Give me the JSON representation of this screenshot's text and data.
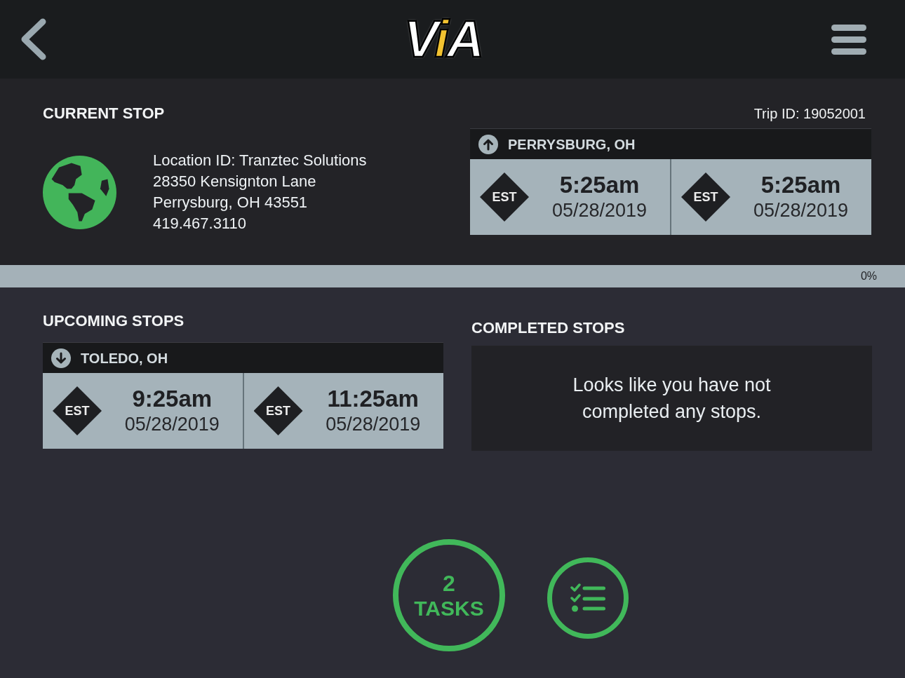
{
  "header": {
    "logo": "ViA"
  },
  "current_stop": {
    "title": "CURRENT STOP",
    "trip_id": "Trip ID: 19052001",
    "details": [
      "Location ID: Tranztec Solutions",
      "28350 Kensignton Lane",
      "Perrysburg, OH 43551",
      "419.467.3110"
    ],
    "stop": {
      "city": "PERRYSBURG, OH",
      "kind": "up",
      "times": [
        {
          "zone": "EST",
          "time": "5:25am",
          "date": "05/28/2019"
        },
        {
          "zone": "EST",
          "time": "5:25am",
          "date": "05/28/2019"
        }
      ]
    }
  },
  "progress": {
    "level": 0,
    "reading": "0%"
  },
  "upcoming_stops": {
    "title": "UPCOMING STOPS",
    "stops": [
      {
        "city": "TOLEDO, OH",
        "kind": "down",
        "times": [
          {
            "zone": "EST",
            "time": "9:25am",
            "date": "05/28/2019"
          },
          {
            "zone": "EST",
            "time": "11:25am",
            "date": "05/28/2019"
          }
        ]
      }
    ]
  },
  "completed_stops": {
    "title": "COMPLETED STOPS",
    "empty_message": "Looks like you have not completed any stops."
  },
  "actions": {
    "tasks": {
      "count": "2",
      "label": "TASKS"
    }
  }
}
